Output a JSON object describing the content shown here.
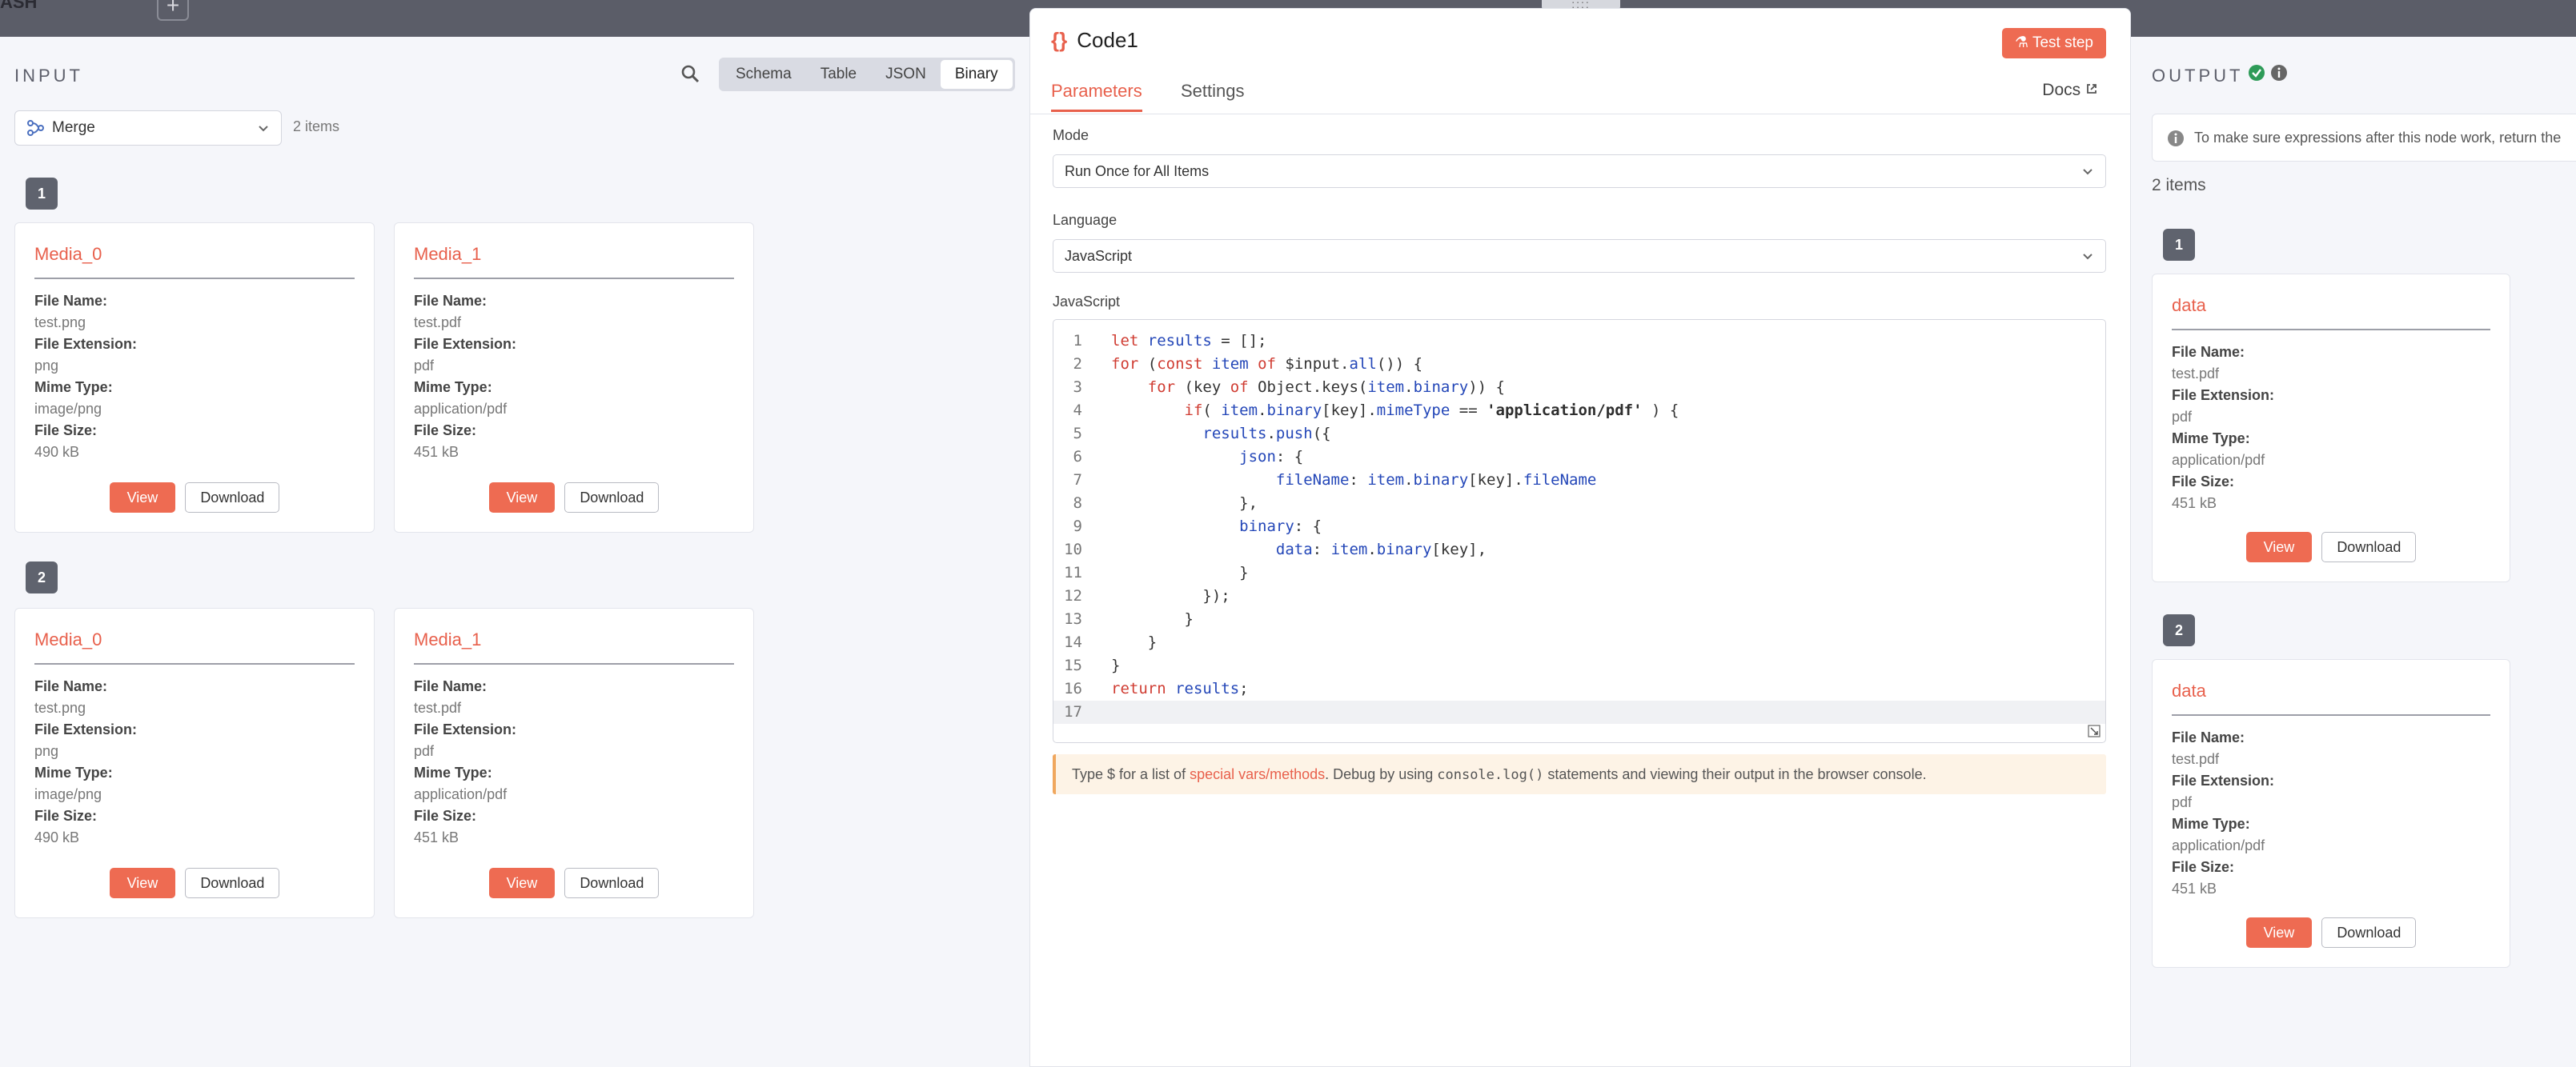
{
  "topbar": {
    "crumb": "ASH",
    "plus": "+"
  },
  "input": {
    "title": "INPUT",
    "tabs": [
      "Schema",
      "Table",
      "JSON",
      "Binary"
    ],
    "active_tab": "Binary",
    "source_select": "Merge",
    "items_count": "2 items",
    "runs": [
      {
        "badge": "1",
        "cards": [
          {
            "name": "Media_0",
            "file_name": "test.png",
            "file_ext": "png",
            "mime": "image/png",
            "size": "490 kB"
          },
          {
            "name": "Media_1",
            "file_name": "test.pdf",
            "file_ext": "pdf",
            "mime": "application/pdf",
            "size": "451 kB"
          }
        ]
      },
      {
        "badge": "2",
        "cards": [
          {
            "name": "Media_0",
            "file_name": "test.png",
            "file_ext": "png",
            "mime": "image/png",
            "size": "490 kB"
          },
          {
            "name": "Media_1",
            "file_name": "test.pdf",
            "file_ext": "pdf",
            "mime": "application/pdf",
            "size": "451 kB"
          }
        ]
      }
    ]
  },
  "labels": {
    "file_name": "File Name:",
    "file_ext": "File Extension:",
    "mime": "Mime Type:",
    "size": "File Size:",
    "view": "View",
    "download": "Download"
  },
  "node": {
    "drag": "::::",
    "icon": "{}",
    "title": "Code1",
    "test_step": "Test step",
    "tab_parameters": "Parameters",
    "tab_settings": "Settings",
    "docs": "Docs",
    "mode_label": "Mode",
    "mode_value": "Run Once for All Items",
    "lang_label": "Language",
    "lang_value": "JavaScript",
    "editor_label": "JavaScript",
    "hint_pre": "Type $ for a list of ",
    "hint_link": "special vars/methods",
    "hint_mid": ". Debug by using ",
    "hint_code": "console.log()",
    "hint_post": " statements and viewing their output in the browser console."
  },
  "code_lines": [
    "let results = [];",
    "for (const item of $input.all()) {",
    "    for (key of Object.keys(item.binary)) {",
    "        if( item.binary[key].mimeType == 'application/pdf' ) {",
    "          results.push({",
    "              json: {",
    "                  fileName: item.binary[key].fileName",
    "              },",
    "              binary: {",
    "                  data: item.binary[key],",
    "              }",
    "          });",
    "        }",
    "    }",
    "}",
    "return results;",
    ""
  ],
  "output": {
    "title": "OUTPUT",
    "callout": "To make sure expressions after this node work, return the",
    "items_count": "2 items",
    "runs": [
      {
        "badge": "1",
        "card": {
          "name": "data",
          "file_name": "test.pdf",
          "file_ext": "pdf",
          "mime": "application/pdf",
          "size": "451 kB"
        }
      },
      {
        "badge": "2",
        "card": {
          "name": "data",
          "file_name": "test.pdf",
          "file_ext": "pdf",
          "mime": "application/pdf",
          "size": "451 kB"
        }
      }
    ]
  },
  "colors": {
    "accent": "#ee6b52",
    "success": "#2e9b58",
    "badge": "#5f636e"
  }
}
